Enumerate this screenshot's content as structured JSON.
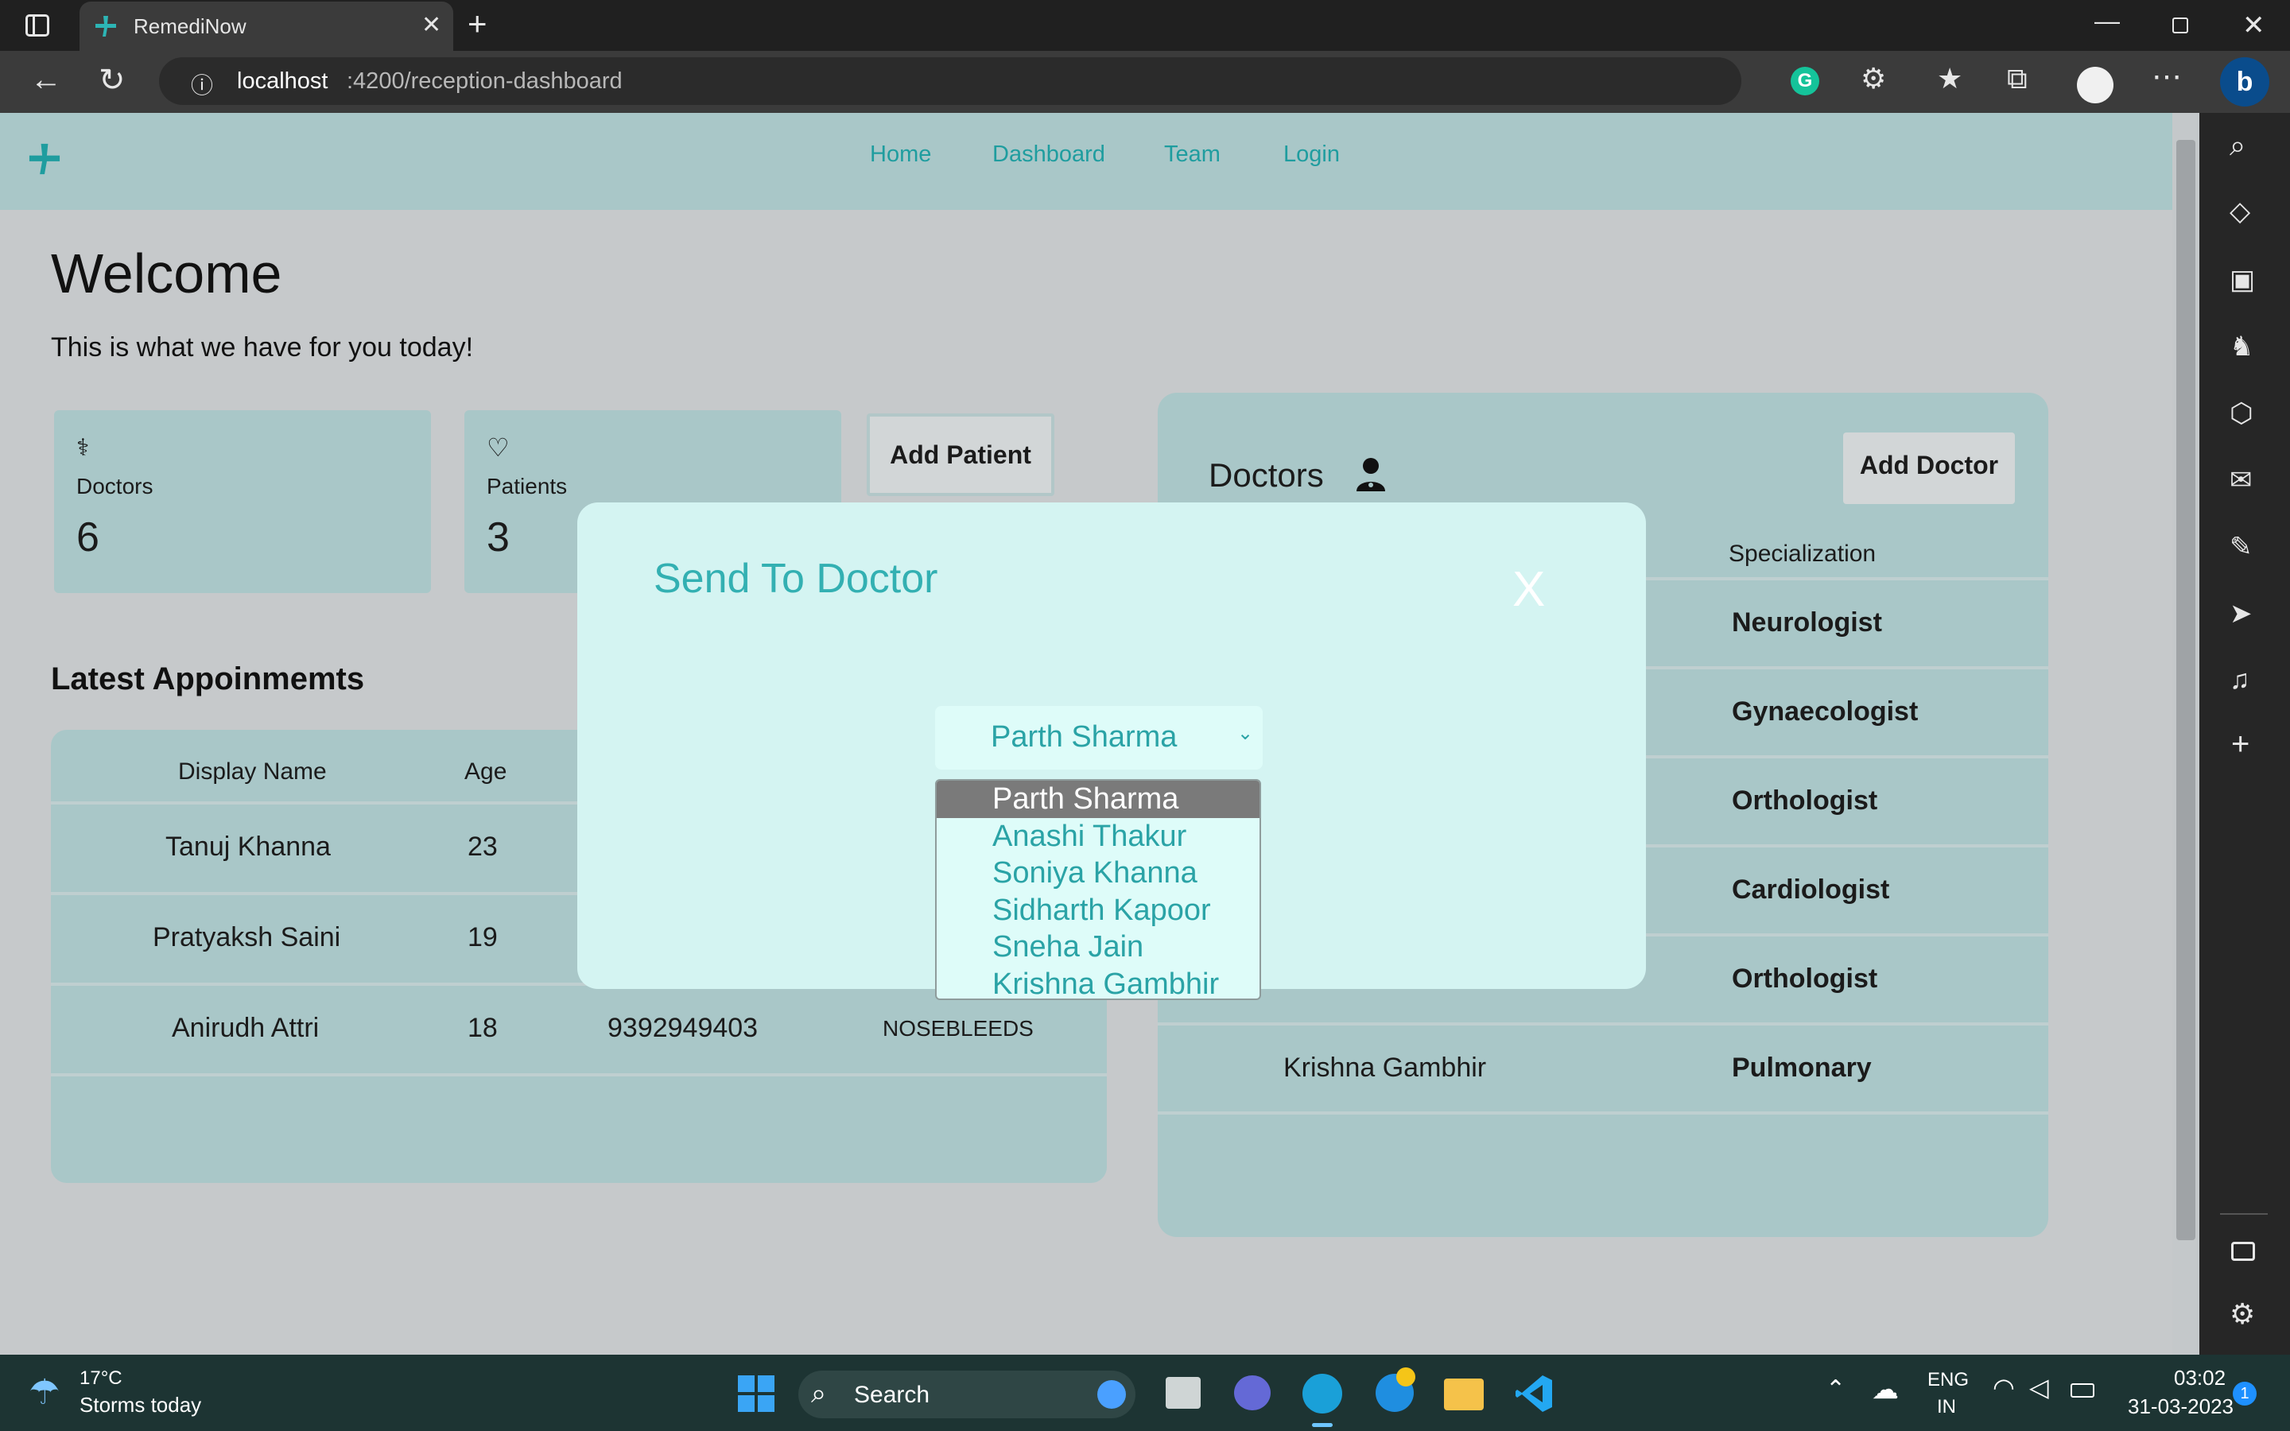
{
  "browser": {
    "tab_title": "RemediNow",
    "url_host": "localhost",
    "url_rest": ":4200/reception-dashboard"
  },
  "nav": {
    "links": [
      "Home",
      "Dashboard",
      "Team",
      "Login"
    ]
  },
  "welcome": {
    "title": "Welcome",
    "subtitle": "This is what we have for you today!"
  },
  "stats": {
    "doctors_label": "Doctors",
    "doctors_value": "6",
    "patients_label": "Patients",
    "patients_value": "3",
    "add_patient": "Add Patient"
  },
  "appointments": {
    "title": "Latest Appoinmemts",
    "headers": [
      "Display Name",
      "Age"
    ],
    "rows": [
      {
        "name": "Tanuj Khanna",
        "age": "23",
        "phone": "",
        "issue": ""
      },
      {
        "name": "Pratyaksh Saini",
        "age": "19",
        "phone": "",
        "issue": ""
      },
      {
        "name": "Anirudh Attri",
        "age": "18",
        "phone": "9392949403",
        "issue": "NOSEBLEEDS"
      }
    ]
  },
  "doctors_panel": {
    "title": "Doctors",
    "add_doctor": "Add Doctor",
    "header_specialization": "Specialization",
    "rows": [
      {
        "name": "",
        "spec": "Neurologist"
      },
      {
        "name": "",
        "spec": "Gynaecologist"
      },
      {
        "name": "",
        "spec": "Orthologist"
      },
      {
        "name": "",
        "spec": "Cardiologist"
      },
      {
        "name": "Sneha Jain",
        "spec": "Orthologist"
      },
      {
        "name": "Krishna Gambhir",
        "spec": "Pulmonary"
      }
    ]
  },
  "modal": {
    "title": "Send To Doctor",
    "close": "X",
    "selected": "Parth Sharma",
    "options": [
      "Parth Sharma",
      "Anashi Thakur",
      "Soniya Khanna",
      "Sidharth Kapoor",
      "Sneha Jain",
      "Krishna Gambhir"
    ]
  },
  "taskbar": {
    "weather_temp": "17°C",
    "weather_desc": "Storms today",
    "search": "Search",
    "lang": "ENG",
    "region": "IN",
    "time": "03:02",
    "date": "31-03-2023",
    "notif_count": "1"
  },
  "colors": {
    "accent": "#1f9d9f",
    "navbar": "#a9c7c8",
    "modal_bg": "#d4f4f2",
    "overlay": "#c6c9cb"
  }
}
